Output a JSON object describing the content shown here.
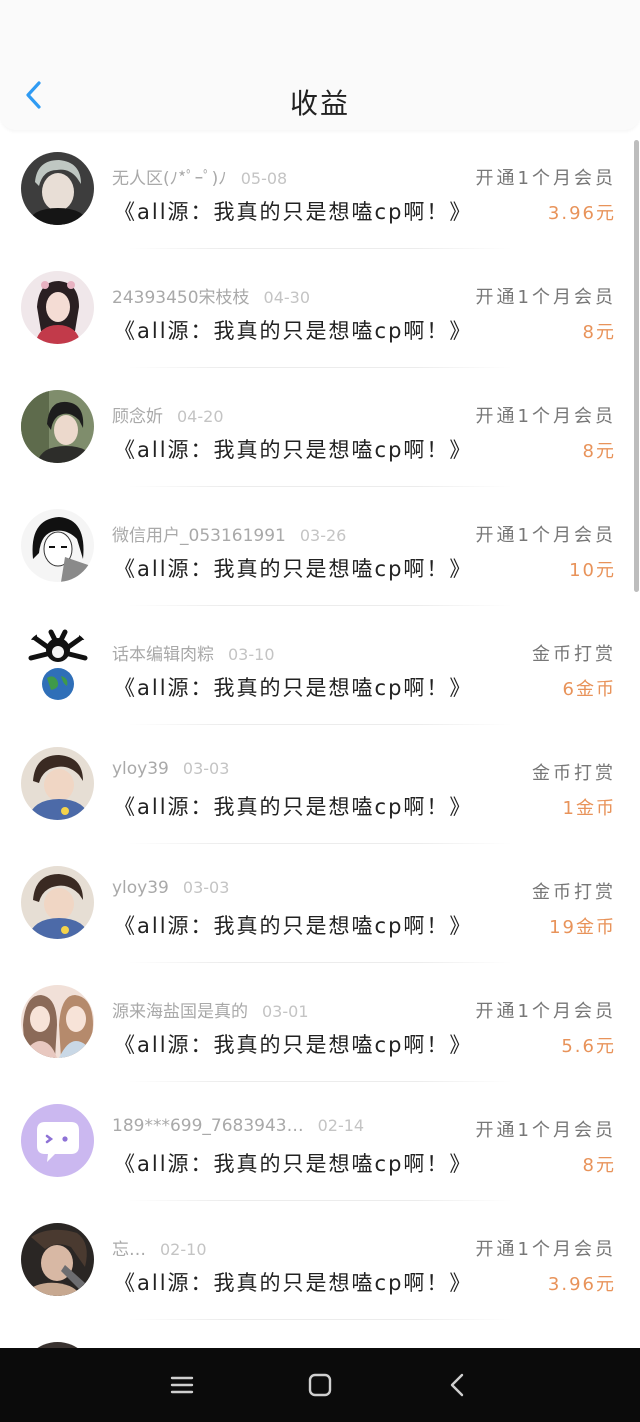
{
  "header": {
    "title": "收益",
    "back_icon": "chevron-left-icon",
    "accent_color": "#2f9bf3"
  },
  "records": [
    {
      "user": "无人区(ﾉ*ﾟｰﾟ)ﾉ",
      "date": "05-08",
      "type": "开通1个月会员",
      "work": "《all源：我真的只是想嗑cp啊！》",
      "amount": "3.96元"
    },
    {
      "user": "24393450宋枝枝",
      "date": "04-30",
      "type": "开通1个月会员",
      "work": "《all源：我真的只是想嗑cp啊！》",
      "amount": "8元"
    },
    {
      "user": "顾念妡",
      "date": "04-20",
      "type": "开通1个月会员",
      "work": "《all源：我真的只是想嗑cp啊！》",
      "amount": "8元"
    },
    {
      "user": "微信用户_053161991",
      "date": "03-26",
      "type": "开通1个月会员",
      "work": "《all源：我真的只是想嗑cp啊！》",
      "amount": "10元"
    },
    {
      "user": "话本编辑肉粽",
      "date": "03-10",
      "type": "金币打赏",
      "work": "《all源：我真的只是想嗑cp啊！》",
      "amount": "6金币"
    },
    {
      "user": "yloy39",
      "date": "03-03",
      "type": "金币打赏",
      "work": "《all源：我真的只是想嗑cp啊！》",
      "amount": "1金币"
    },
    {
      "user": "yloy39",
      "date": "03-03",
      "type": "金币打赏",
      "work": "《all源：我真的只是想嗑cp啊！》",
      "amount": "19金币"
    },
    {
      "user": "源来海盐国是真的",
      "date": "03-01",
      "type": "开通1个月会员",
      "work": "《all源：我真的只是想嗑cp啊！》",
      "amount": "5.6元"
    },
    {
      "user": "189***699_7683943…",
      "date": "02-14",
      "type": "开通1个月会员",
      "work": "《all源：我真的只是想嗑cp啊！》",
      "amount": "8元"
    },
    {
      "user": "忘…",
      "date": "02-10",
      "type": "开通1个月会员",
      "work": "《all源：我真的只是想嗑cp啊！》",
      "amount": "3.96元"
    }
  ],
  "colors": {
    "amount": "#e8935a",
    "meta_text": "#a9a9a9",
    "title_text": "#222222",
    "nav_bar": "#0b0b0b"
  },
  "navbar": {
    "buttons": [
      "menu-icon",
      "home-square-icon",
      "back-triangle-icon"
    ]
  }
}
